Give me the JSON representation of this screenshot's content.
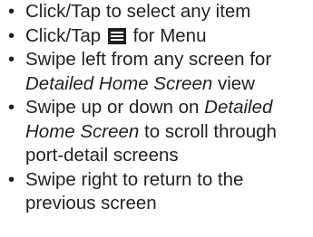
{
  "instructions": {
    "bullet": "•",
    "items": [
      {
        "text": "Click/Tap to select any item"
      },
      {
        "before": "Click/Tap",
        "icon": "menu-icon",
        "after": "for Menu"
      },
      {
        "before": "Swipe left from any screen for",
        "em": "Detailed Home Screen",
        "after": "view"
      },
      {
        "before": "Swipe up or down on",
        "em": "Detailed Home Screen",
        "after": "to scroll through port-detail screens"
      },
      {
        "text": "Swipe right to return to the previous screen"
      }
    ]
  }
}
